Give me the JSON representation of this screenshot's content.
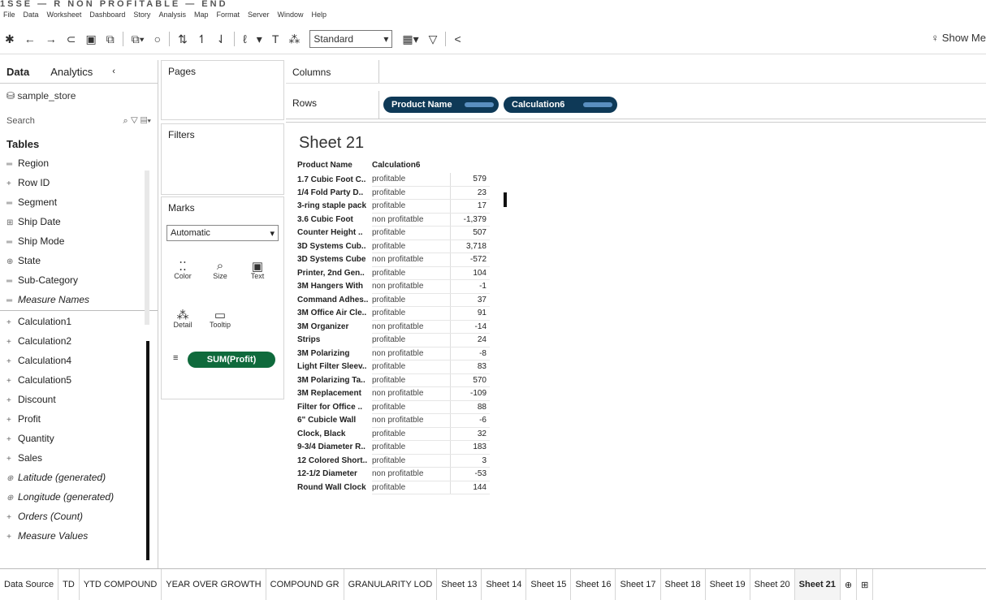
{
  "title": "1SSE — R NON PROFITABLE — END",
  "menu": [
    "File",
    "Data",
    "Worksheet",
    "Dashboard",
    "Story",
    "Analysis",
    "Map",
    "Format",
    "Server",
    "Window",
    "Help"
  ],
  "toolbar": {
    "mark_type_select": "Standard",
    "show_me_label": "Show Me"
  },
  "left_pane": {
    "tab_data": "Data",
    "tab_analytics": "Analytics",
    "datasource": "sample_store",
    "search_placeholder": "Search",
    "tables_title": "Tables",
    "dimensions": [
      {
        "icon": "abc",
        "label": "Region",
        "italic": false
      },
      {
        "icon": "#",
        "label": "Row ID",
        "italic": false
      },
      {
        "icon": "abc",
        "label": "Segment",
        "italic": false
      },
      {
        "icon": "date",
        "label": "Ship Date",
        "italic": false
      },
      {
        "icon": "abc",
        "label": "Ship Mode",
        "italic": false
      },
      {
        "icon": "geo",
        "label": "State",
        "italic": false
      },
      {
        "icon": "abc",
        "label": "Sub-Category",
        "italic": false
      },
      {
        "icon": "abc",
        "label": "Measure Names",
        "italic": true
      }
    ],
    "measures": [
      {
        "icon": "#",
        "label": "Calculation1",
        "italic": false
      },
      {
        "icon": "#",
        "label": "Calculation2",
        "italic": false
      },
      {
        "icon": "#",
        "label": "Calculation4",
        "italic": false
      },
      {
        "icon": "#",
        "label": "Calculation5",
        "italic": false
      },
      {
        "icon": "#",
        "label": "Discount",
        "italic": false
      },
      {
        "icon": "#",
        "label": "Profit",
        "italic": false
      },
      {
        "icon": "#",
        "label": "Quantity",
        "italic": false
      },
      {
        "icon": "#",
        "label": "Sales",
        "italic": false
      },
      {
        "icon": "geo",
        "label": "Latitude (generated)",
        "italic": true
      },
      {
        "icon": "geo",
        "label": "Longitude (generated)",
        "italic": true
      },
      {
        "icon": "#",
        "label": "Orders (Count)",
        "italic": true
      },
      {
        "icon": "#",
        "label": "Measure Values",
        "italic": true
      }
    ]
  },
  "shelves": {
    "pages": "Pages",
    "filters": "Filters",
    "marks": "Marks",
    "marks_type": "Automatic",
    "mark_buttons": [
      {
        "label": "Color",
        "icon": "color-icon"
      },
      {
        "label": "Size",
        "icon": "size-icon"
      },
      {
        "label": "Text",
        "icon": "text-icon"
      },
      {
        "label": "Detail",
        "icon": "detail-icon"
      },
      {
        "label": "Tooltip",
        "icon": "tooltip-icon"
      }
    ],
    "marks_pill": "SUM(Profit)",
    "columns_label": "Columns",
    "rows_label": "Rows",
    "row_pills": [
      "Product Name",
      "Calculation6"
    ]
  },
  "view": {
    "sheet_title": "Sheet 21",
    "headers": [
      "Product Name",
      "Calculation6",
      ""
    ],
    "rows": [
      [
        "1.7 Cubic Foot C..",
        "profitable",
        "579"
      ],
      [
        "1/4 Fold Party D..",
        "profitable",
        "23"
      ],
      [
        "3-ring staple pack",
        "profitable",
        "17"
      ],
      [
        "3.6 Cubic Foot",
        "non profitatble",
        "-1,379"
      ],
      [
        "Counter Height ..",
        "profitable",
        "507"
      ],
      [
        "3D Systems Cub..",
        "profitable",
        "3,718"
      ],
      [
        "3D Systems Cube",
        "non profitatble",
        "-572"
      ],
      [
        "Printer, 2nd Gen..",
        "profitable",
        "104"
      ],
      [
        "3M Hangers With",
        "non profitatble",
        "-1"
      ],
      [
        "Command Adhes..",
        "profitable",
        "37"
      ],
      [
        "3M Office Air Cle..",
        "profitable",
        "91"
      ],
      [
        "3M Organizer",
        "non profitatble",
        "-14"
      ],
      [
        "Strips",
        "profitable",
        "24"
      ],
      [
        "3M Polarizing",
        "non profitatble",
        "-8"
      ],
      [
        "Light Filter Sleev..",
        "profitable",
        "83"
      ],
      [
        "3M Polarizing Ta..",
        "profitable",
        "570"
      ],
      [
        "3M Replacement",
        "non profitatble",
        "-109"
      ],
      [
        "Filter for Office ..",
        "profitable",
        "88"
      ],
      [
        "6\" Cubicle Wall",
        "non profitatble",
        "-6"
      ],
      [
        "Clock, Black",
        "profitable",
        "32"
      ],
      [
        "9-3/4 Diameter R..",
        "profitable",
        "183"
      ],
      [
        "12 Colored Short..",
        "profitable",
        "3"
      ],
      [
        "12-1/2 Diameter",
        "non profitatble",
        "-53"
      ],
      [
        "Round Wall Clock",
        "profitable",
        "144"
      ]
    ]
  },
  "bottom_tabs": [
    {
      "label": "Data Source",
      "active": false
    },
    {
      "label": "TD",
      "active": false
    },
    {
      "label": "YTD COMPOUND",
      "active": false
    },
    {
      "label": "YEAR OVER GROWTH",
      "active": false
    },
    {
      "label": "COMPOUND GR",
      "active": false
    },
    {
      "label": "GRANULARITY LOD",
      "active": false
    },
    {
      "label": "Sheet 13",
      "active": false
    },
    {
      "label": "Sheet 14",
      "active": false
    },
    {
      "label": "Sheet 15",
      "active": false
    },
    {
      "label": "Sheet 16",
      "active": false
    },
    {
      "label": "Sheet 17",
      "active": false
    },
    {
      "label": "Sheet 18",
      "active": false
    },
    {
      "label": "Sheet 19",
      "active": false
    },
    {
      "label": "Sheet 20",
      "active": false
    },
    {
      "label": "Sheet 21",
      "active": true
    }
  ]
}
